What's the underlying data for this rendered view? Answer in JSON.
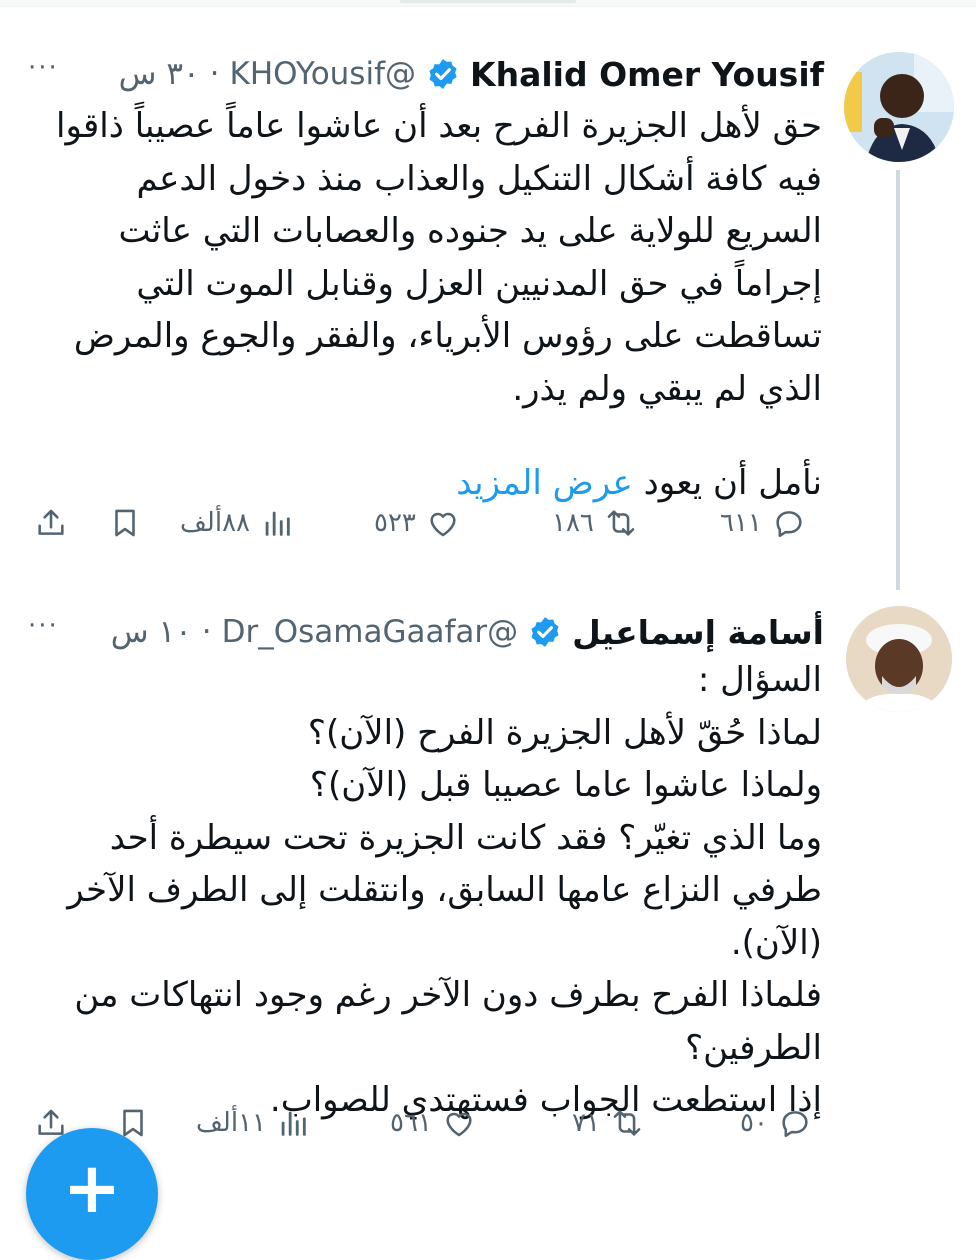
{
  "tweets": [
    {
      "name": "Khalid Omer Yousif",
      "handle": "@KHOYousif",
      "separator": "·",
      "time": "٣٠ س",
      "more": "···",
      "lines": [
        "حق لأهل الجزيرة الفرح بعد أن عاشوا عاماً عصيباً ذاقوا",
        "فيه كافة أشكال التنكيل والعذاب منذ دخول الدعم",
        "السريع للولاية على يد جنوده والعصابات التي عاثت",
        "إجراماً في حق المدنيين العزل وقنابل الموت التي",
        "تساقطت على رؤوس الأبرياء، والفقر والجوع والمرض",
        "الذي لم يبقي ولم يذر."
      ],
      "last_line": "نأمل أن يعود",
      "show_more": "عرض المزيد",
      "replies": "٦١١",
      "retweets": "١٨٦",
      "likes": "٥٢٣",
      "views": "٨٨ألف"
    },
    {
      "name": "أسامة إسماعيل",
      "handle": "@Dr_OsamaGaafar",
      "separator": "·",
      "time": "١٠ س",
      "more": "···",
      "lines": [
        "السؤال :",
        "لماذا حُقّ لأهل الجزيرة الفرح (الآن)؟",
        "ولماذا عاشوا عاما عصيبا قبل (الآن)؟",
        "وما الذي تغيّر؟ فقد كانت الجزيرة تحت سيطرة أحد",
        "طرفي النزاع عامها السابق، وانتقلت إلى الطرف الآخر",
        "(الآن).",
        "فلماذا الفرح بطرف دون الآخر رغم وجود انتهاكات من",
        "الطرفين؟",
        "إذا استطعت الجواب فستهتدي للصواب."
      ],
      "replies": "٥٠",
      "retweets": "٧١",
      "likes": "٥٦١",
      "views": "١١ألف"
    }
  ],
  "fab_label": "+",
  "colors": {
    "accent": "#1d9bf0",
    "text": "#0f1419",
    "secondary": "#536471"
  },
  "icons": [
    "verified-badge-icon",
    "more-icon",
    "reply-icon",
    "retweet-icon",
    "like-icon",
    "views-icon",
    "bookmark-icon",
    "share-icon",
    "plus-icon"
  ]
}
